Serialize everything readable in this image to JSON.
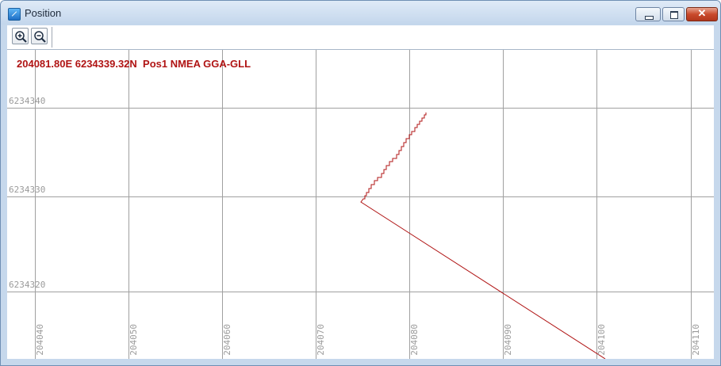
{
  "window": {
    "title": "Position",
    "app_icon": "position-app-icon"
  },
  "toolbar": {
    "zoom_in": "zoom-in-icon",
    "zoom_out": "zoom-out-icon"
  },
  "readout": {
    "text": "204081.80E 6234339.32N  Pos1 NMEA GGA-GLL"
  },
  "axes": {
    "y_ticks": [
      "6234340",
      "6234330",
      "6234320"
    ],
    "x_ticks": [
      "204040",
      "204050",
      "204060",
      "204070",
      "204080",
      "204090",
      "204100",
      "204110"
    ]
  },
  "colors": {
    "track": "#b01414",
    "grid": "#a0a0a0",
    "label": "#9a9a9a"
  }
}
